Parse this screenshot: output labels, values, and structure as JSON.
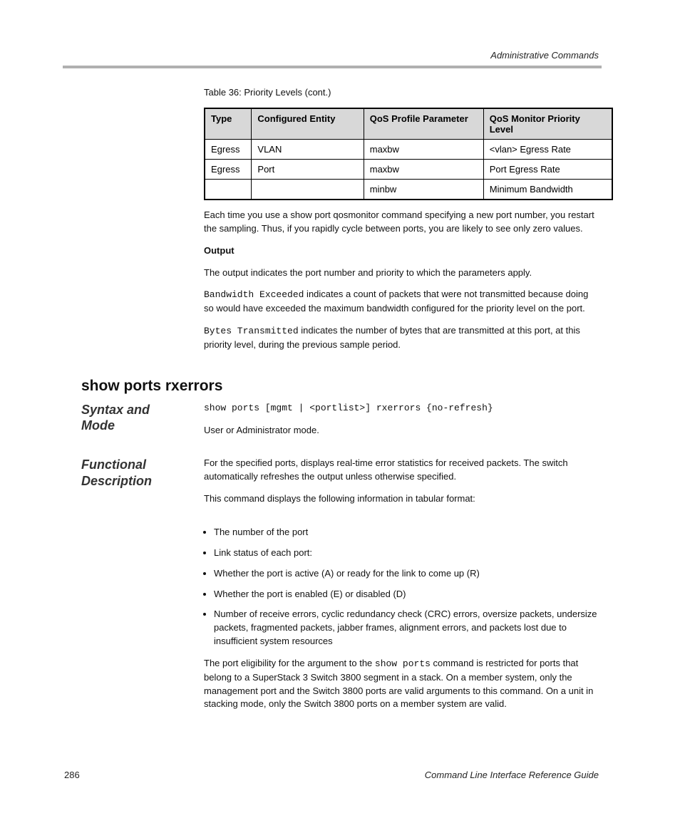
{
  "header_right": "Administrative Commands",
  "table_label": "Table 36: Priority Levels (cont.)",
  "table": {
    "headers": [
      "Type",
      "Configured Entity",
      "QoS Profile Parameter",
      "QoS Monitor Priority Level"
    ],
    "rows": [
      [
        "Egress",
        "VLAN",
        "maxbw",
        "<vlan> Egress Rate"
      ],
      [
        "Egress",
        "Port",
        "maxbw",
        "Port Egress Rate"
      ],
      [
        "",
        "",
        "minbw",
        "Minimum Bandwidth"
      ]
    ]
  },
  "below": {
    "p1": "Each time you use a show port qosmonitor command specifying a new port number, you restart the sampling. Thus, if you rapidly cycle between ports, you are likely to see only zero values.",
    "output_heading": "Output",
    "output_p1": "The output indicates the port number and priority to which the parameters apply.",
    "output_p2_label": "Bandwidth Exceeded",
    "output_p2_rest": " indicates a count of packets that were not transmitted because doing so would have exceeded the maximum bandwidth configured for the priority level on the port.",
    "output_p3_label": "Bytes Transmitted",
    "output_p3_rest": " indicates the number of bytes that are transmitted at this port, at this priority level, during the previous sample period."
  },
  "section2": {
    "title": "show ports rxerrors",
    "side1": "Syntax and Mode",
    "code": "show ports [mgmt | <portlist>] rxerrors {no-refresh}",
    "mode": "User or Administrator mode.",
    "side2": "Functional Description",
    "p1": "For the specified ports, displays real-time error statistics for received packets. The switch automatically refreshes the output unless otherwise specified.",
    "p2": "This command displays the following information in tabular format:",
    "bullets": [
      "The number of the port",
      "Link status of each port:",
      "Whether the port is active (A) or ready for the link to come up (R)",
      "Whether the port is enabled (E) or disabled (D)",
      "Number of receive errors, cyclic redundancy check (CRC) errors, oversize packets, undersize packets, fragmented packets, jabber frames, alignment errors, and packets lost due to insufficient system resources"
    ],
    "p3_a": "The port eligibility for the argument to the ",
    "p3_mono": "show ports",
    "p3_b": " command is restricted for ports that belong to a SuperStack 3 Switch 3800 segment in a stack. On a member system, only the management port and the Switch 3800 ports are valid arguments to this command. On a unit in stacking mode, only the Switch 3800 ports on a member system are valid."
  },
  "footer": {
    "left": "286",
    "right": "Command Line Interface Reference Guide"
  }
}
